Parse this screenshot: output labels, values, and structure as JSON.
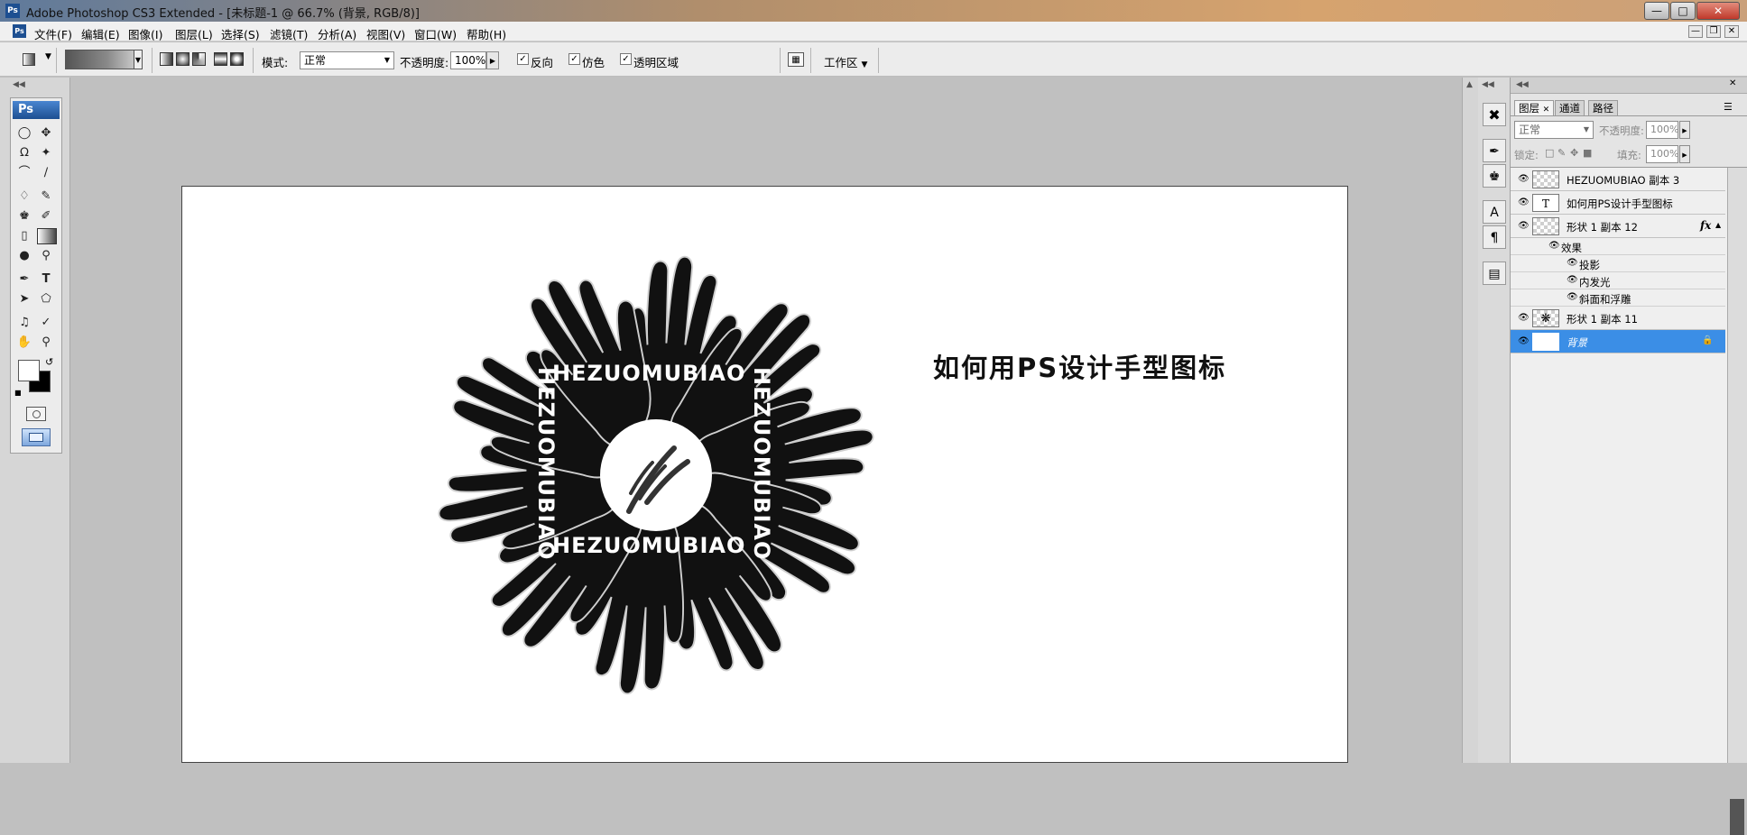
{
  "window": {
    "app_icon": "Ps",
    "title": "Adobe Photoshop CS3 Extended - [未标题-1 @ 66.7% (背景, RGB/8)]",
    "controls": [
      "minimize-icon",
      "maximize-icon",
      "close-icon"
    ]
  },
  "menu": {
    "doc_icon": "Ps",
    "items": [
      "文件(F)",
      "编辑(E)",
      "图像(I)",
      "图层(L)",
      "选择(S)",
      "滤镜(T)",
      "分析(A)",
      "视图(V)",
      "窗口(W)",
      "帮助(H)"
    ]
  },
  "options": {
    "mode_label": "模式:",
    "mode_value": "正常",
    "opacity_label": "不透明度:",
    "opacity_value": "100%",
    "reverse_label": "反向",
    "dither_label": "仿色",
    "transparency_label": "透明区域",
    "workspace_label": "工作区"
  },
  "toolbox": {
    "logo": "Ps"
  },
  "canvas": {
    "headline": "如何用PS设计手型图标",
    "ring_text": "HEZUOMUBIAO",
    "colors": {
      "page": "#ffffff",
      "artwork": "#111111",
      "outline": "#cfcfcf"
    }
  },
  "layers_panel": {
    "tabs": [
      "图层",
      "通道",
      "路径"
    ],
    "blend_mode": "正常",
    "opacity_label": "不透明度:",
    "opacity_value": "100%",
    "lock_label": "锁定:",
    "fill_label": "填充:",
    "fill_value": "100%",
    "layers": [
      {
        "name": "HEZUOMUBIAO 副本 3",
        "thumb": "",
        "selected": false
      },
      {
        "name": "如何用PS设计手型图标",
        "thumb": "T",
        "selected": false
      },
      {
        "name": "形状 1 副本 12",
        "thumb": "",
        "selected": false,
        "fx": "fx"
      },
      {
        "name": "形状 1 副本 11",
        "thumb": "",
        "selected": false
      },
      {
        "name": "背景",
        "thumb": "",
        "selected": true
      }
    ],
    "effects_label": "效果",
    "effects": [
      "投影",
      "内发光",
      "斜面和浮雕"
    ],
    "selection_color": "#3b8ee6"
  }
}
